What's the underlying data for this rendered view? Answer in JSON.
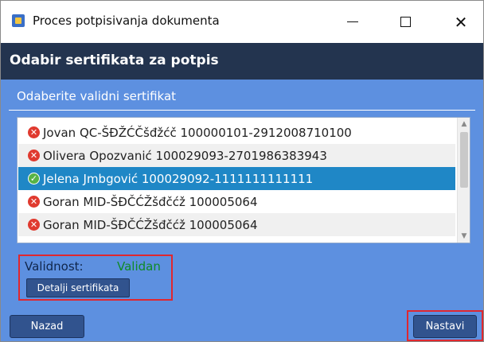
{
  "window": {
    "title": "Proces potpisivanja dokumenta",
    "minimize_symbol": "",
    "close_symbol": "✕"
  },
  "header": {
    "title": "Odabir sertifikata za potpis"
  },
  "subheader": {
    "title": "Odaberite validni sertifikat"
  },
  "certificates": [
    {
      "label": "Jovan QC-ŠĐŽĆČšđžćč 100000101-2912008710100",
      "status": "invalid",
      "icon": "error-icon"
    },
    {
      "label": "Olivera Opozvanić 100029093-2701986383943",
      "status": "invalid",
      "icon": "error-icon"
    },
    {
      "label": "Jelena Jmbgović 100029092-1111111111111",
      "status": "valid",
      "icon": "check-icon",
      "selected": true
    },
    {
      "label": "Goran MID-ŠĐČĆŽšđčćž 100005064",
      "status": "invalid",
      "icon": "error-icon"
    },
    {
      "label": "Goran MID-ŠĐČĆŽšđčćž 100005064",
      "status": "invalid",
      "icon": "error-icon"
    }
  ],
  "validity": {
    "label": "Validnost:",
    "value": "Validan",
    "value_color": "#0f8a26"
  },
  "buttons": {
    "details": "Detalji sertifikata",
    "back": "Nazad",
    "next": "Nastavi"
  },
  "colors": {
    "header_bg": "#23344f",
    "content_bg": "#5d90e0",
    "selected_row": "#1f87c6",
    "button_bg": "#31538e",
    "highlight_border": "#e0272f"
  }
}
